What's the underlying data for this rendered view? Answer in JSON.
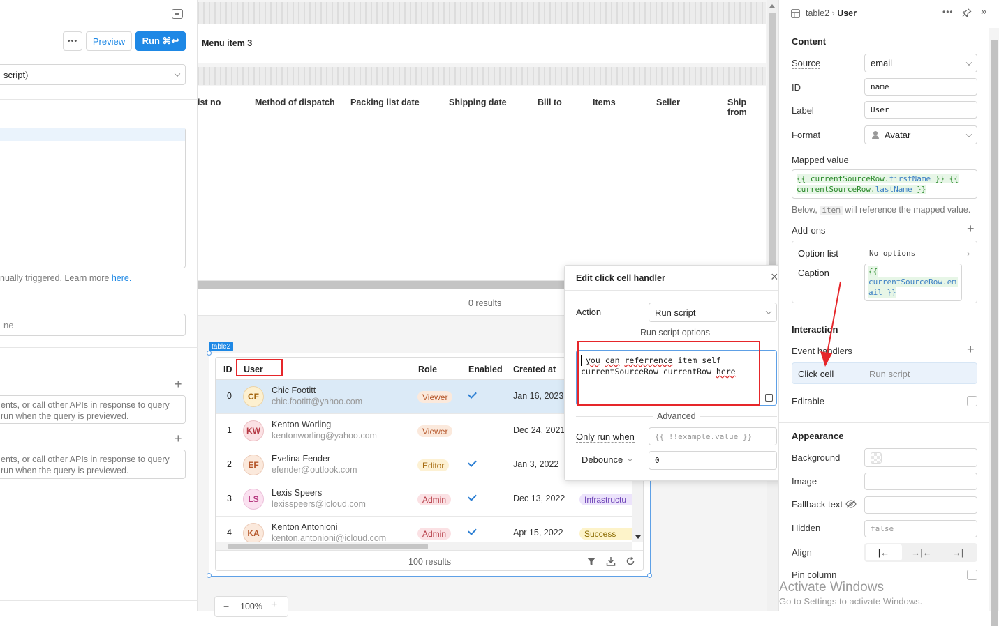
{
  "left_panel": {
    "more_label": "•••",
    "preview_label": "Preview",
    "run_label": "Run ⌘↩",
    "resource_value": "script)",
    "trigger_hint_prefix": "nually triggered. Learn more ",
    "trigger_hint_link": "here.",
    "timeout_value": "ne",
    "success_hint_line1": "ents, or call other APIs in response to query",
    "success_hint_line2": " run when the query is previewed.",
    "failure_hint_line1": "ents, or call other APIs in response to query",
    "failure_hint_line2": "run when the query is previewed."
  },
  "canvas": {
    "menu_item": "Menu item 3",
    "top_table_headers": [
      "ist no",
      "Method of dispatch",
      "Packing list date",
      "Shipping date",
      "Bill to",
      "Items",
      "Seller",
      "Ship from"
    ],
    "top_results": "0 results",
    "table_tag": "table2",
    "table_headers": {
      "id": "ID",
      "user": "User",
      "role": "Role",
      "enabled": "Enabled",
      "created": "Created at"
    },
    "rows": [
      {
        "id": "0",
        "initials": "CF",
        "name": "Chic Footitt",
        "email": "chic.footitt@yahoo.com",
        "role": "Viewer",
        "enabled": true,
        "created": "Jan 16, 2023",
        "extra": ""
      },
      {
        "id": "1",
        "initials": "KW",
        "name": "Kenton Worling",
        "email": "kentonworling@yahoo.com",
        "role": "Viewer",
        "enabled": false,
        "created": "Dec 24, 2021",
        "extra": ""
      },
      {
        "id": "2",
        "initials": "EF",
        "name": "Evelina Fender",
        "email": "efender@outlook.com",
        "role": "Editor",
        "enabled": true,
        "created": "Jan 3, 2022",
        "extra": ""
      },
      {
        "id": "3",
        "initials": "LS",
        "name": "Lexis Speers",
        "email": "lexisspeers@icloud.com",
        "role": "Admin",
        "enabled": true,
        "created": "Dec 13, 2022",
        "extra": "Infrastructu"
      },
      {
        "id": "4",
        "initials": "KA",
        "name": "Kenton Antonioni",
        "email": "kenton.antonioni@icloud.com",
        "role": "Admin",
        "enabled": true,
        "created": "Apr 15, 2022",
        "extra": "Success"
      }
    ],
    "results": "100 results",
    "zoom": "100%",
    "zoom_minus": "−",
    "zoom_plus": "+"
  },
  "modal": {
    "title": "Edit click cell handler",
    "close": "×",
    "action_label": "Action",
    "action_value": "Run script",
    "script_section": "Run script options",
    "script_line1_words": [
      "you",
      "can",
      "referrence",
      "item",
      "self"
    ],
    "script_line2_words": [
      "currentSourceRow",
      "currentRow",
      "here"
    ],
    "advanced": "Advanced",
    "only_run_label": "Only run when",
    "only_run_placeholder": "{{ !!example.value }}",
    "debounce_label": "Debounce",
    "debounce_value": "0"
  },
  "inspector": {
    "breadcrumb_component": "table2",
    "breadcrumb_sep": "›",
    "breadcrumb_column": "User",
    "content_title": "Content",
    "source_label": "Source",
    "source_value": "email",
    "id_label": "ID",
    "id_value": "name",
    "label_label": "Label",
    "label_value": "User",
    "format_label": "Format",
    "format_value": "Avatar",
    "mapped_label": "Mapped value",
    "mapped_line1_parts": [
      "{{ ",
      "currentSourceRow",
      ".",
      "firstName",
      " }} {{"
    ],
    "mapped_line2_parts": [
      "currentSourceRow",
      ".",
      "lastName",
      " }}"
    ],
    "below_prefix": "Below, ",
    "below_code": "item",
    "below_suffix": " will reference the mapped value.",
    "addons_label": "Add-ons",
    "option_list_label": "Option list",
    "option_list_value": "No options",
    "caption_label": "Caption",
    "caption_lines": [
      "{{",
      "currentSourceRow.em",
      "ail }}"
    ],
    "interaction_title": "Interaction",
    "event_handlers_label": "Event handlers",
    "click_cell": "Click cell",
    "run_script": "Run script",
    "editable_label": "Editable",
    "appearance_title": "Appearance",
    "background_label": "Background",
    "image_label": "Image",
    "fallback_label": "Fallback text",
    "hidden_label": "Hidden",
    "hidden_value": "false",
    "align_label": "Align",
    "pin_label": "Pin column"
  },
  "watermark": {
    "line1": "Activate Windows",
    "line2": "Go to Settings to activate Windows."
  },
  "colors": {
    "accent": "#1e88e5",
    "annotation_red": "#e6262a"
  }
}
